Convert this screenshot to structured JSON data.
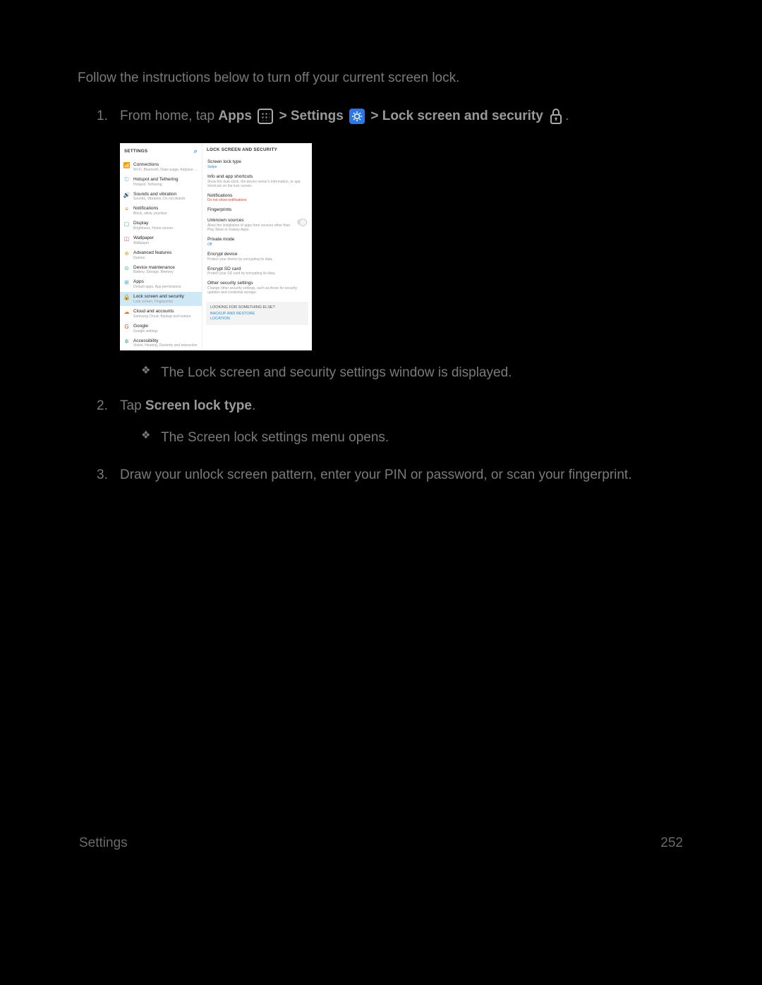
{
  "intro": "Follow the instructions below to turn off your current screen lock.",
  "steps": {
    "s1": {
      "pre": "From home, tap ",
      "apps": "Apps",
      "gt1": " > ",
      "settings": "Settings",
      "gt2": " > ",
      "lock": "Lock screen and security"
    },
    "s2": {
      "pre": "Tap ",
      "bold": "Screen lock type",
      "post": "."
    },
    "s3": "Draw your unlock screen pattern, enter your PIN or password, or scan your fingerprint."
  },
  "bullets": {
    "b1": "The Lock screen and security settings window is displayed.",
    "b2": "The Screen lock settings menu opens."
  },
  "footer": {
    "left": "Settings",
    "right": "252"
  },
  "shot": {
    "leftHeader": "SETTINGS",
    "rightHeader": "LOCK SCREEN AND SECURITY",
    "leftItems": [
      {
        "icon": "📶",
        "color": "#4aa0e6",
        "title": "Connections",
        "sub": "Wi-Fi, Bluetooth, Data usage, Airplane m..."
      },
      {
        "icon": "⎋",
        "color": "#4aa0e6",
        "title": "Hotspot and Tethering",
        "sub": "Hotspot, Tethering"
      },
      {
        "icon": "🔊",
        "color": "#7b5bd6",
        "title": "Sounds and vibration",
        "sub": "Sounds, Vibration, Do not disturb"
      },
      {
        "icon": "≡",
        "color": "#d67b2b",
        "title": "Notifications",
        "sub": "Block, allow, prioritize"
      },
      {
        "icon": "▢",
        "color": "#3bb273",
        "title": "Display",
        "sub": "Brightness, Home screen"
      },
      {
        "icon": "◫",
        "color": "#d65b9b",
        "title": "Wallpaper",
        "sub": "Wallpaper"
      },
      {
        "icon": "⊕",
        "color": "#d6b23b",
        "title": "Advanced features",
        "sub": "Games"
      },
      {
        "icon": "⊙",
        "color": "#3bb2b2",
        "title": "Device maintenance",
        "sub": "Battery, Storage, Memory"
      },
      {
        "icon": "⊞",
        "color": "#4aa0e6",
        "title": "Apps",
        "sub": "Default apps, App permissions"
      },
      {
        "icon": "🔒",
        "color": "#4aa0e6",
        "title": "Lock screen and security",
        "sub": "Lock screen, Fingerprints",
        "selected": true
      },
      {
        "icon": "☁",
        "color": "#d67b2b",
        "title": "Cloud and accounts",
        "sub": "Samsung Cloud, Backup and restore"
      },
      {
        "icon": "G",
        "color": "#d64b2b",
        "title": "Google",
        "sub": "Google settings"
      },
      {
        "icon": "✲",
        "color": "#3bb273",
        "title": "Accessibility",
        "sub": "Vision, Hearing, Dexterity and interaction"
      }
    ],
    "rightItems": [
      {
        "title": "Screen lock type",
        "sub": "Swipe",
        "subClass": "blue"
      },
      {
        "title": "Info and app shortcuts",
        "sub": "Show the dual clock, the device owner's information, or app shortcuts on the lock screen."
      },
      {
        "title": "Notifications",
        "sub": "Do not show notifications",
        "subClass": "red"
      },
      {
        "title": "Fingerprints"
      },
      {
        "title": "Unknown sources",
        "sub": "Allow the installation of apps from sources other than Play Store or Galaxy Apps.",
        "toggle": true
      },
      {
        "title": "Private mode",
        "sub": "Off",
        "subClass": "blue"
      },
      {
        "title": "Encrypt device",
        "sub": "Protect your device by encrypting its data."
      },
      {
        "title": "Encrypt SD card",
        "sub": "Protect your SD card by encrypting its data."
      },
      {
        "title": "Other security settings",
        "sub": "Change other security settings, such as those for security updates and credential storage."
      }
    ],
    "footerBox": {
      "hd": "LOOKING FOR SOMETHING ELSE?",
      "l1": "BACKUP AND RESTORE",
      "l2": "LOCATION"
    }
  }
}
